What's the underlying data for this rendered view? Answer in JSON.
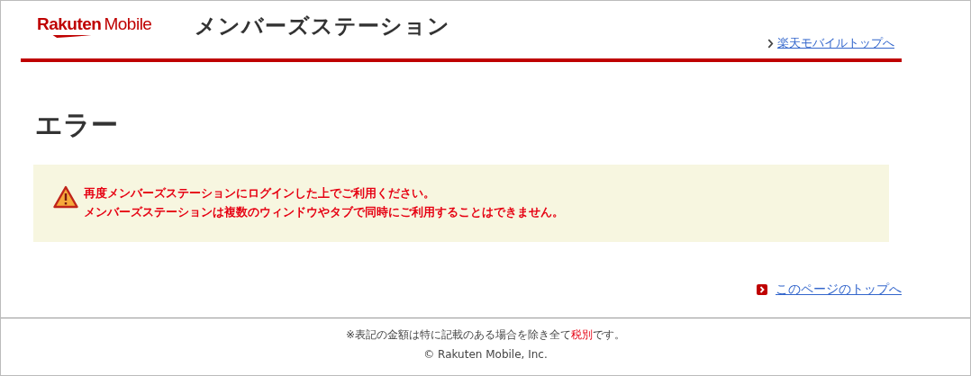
{
  "header": {
    "logo": {
      "brand": "Rakuten",
      "product": "Mobile"
    },
    "title": "メンバーズステーション",
    "top_link": "楽天モバイルトップへ"
  },
  "page": {
    "heading": "エラー",
    "alert": {
      "kind": "warning",
      "lines": [
        "再度メンバーズステーションにログインした上でご利用ください。",
        "メンバーズステーションは複数のウィンドウやタブで同時にご利用することはできません。"
      ]
    },
    "page_top_link": "このページのトップへ"
  },
  "footer": {
    "note": [
      {
        "kind": "plain",
        "text": "※表記の金額は特に記載のある場合を除き全て"
      },
      {
        "kind": "emphasis",
        "text": "税別"
      },
      {
        "kind": "plain",
        "text": "です。"
      }
    ],
    "copyright": "© Rakuten Mobile, Inc."
  }
}
